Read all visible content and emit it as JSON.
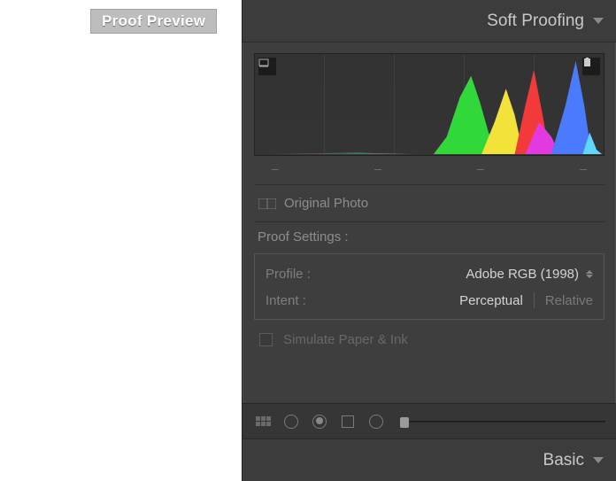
{
  "badge": "Proof Preview",
  "header": {
    "title": "Soft Proofing"
  },
  "footer": {
    "title": "Basic"
  },
  "dashes": [
    "–",
    "–",
    "–",
    "–"
  ],
  "original_photo": {
    "label": "Original Photo"
  },
  "proof_settings": {
    "heading": "Proof Settings :",
    "profile": {
      "label": "Profile :",
      "value": "Adobe RGB (1998)"
    },
    "intent": {
      "label": "Intent :",
      "perceptual": "Perceptual",
      "relative": "Relative"
    }
  },
  "simulate": {
    "label": "Simulate Paper & Ink"
  }
}
